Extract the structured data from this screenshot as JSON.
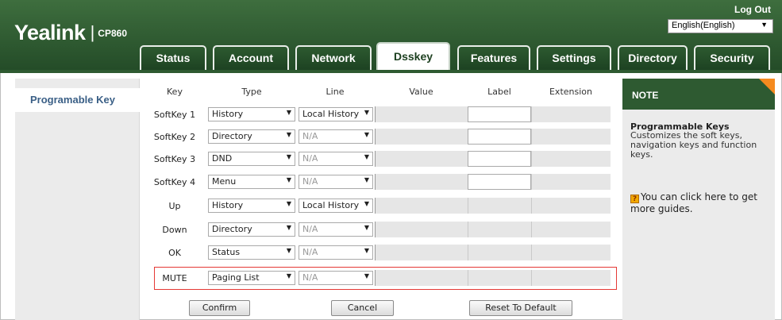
{
  "header": {
    "brand": "Yealink",
    "model": "CP860",
    "logout": "Log Out",
    "language": "English(English)"
  },
  "tabs": [
    {
      "label": "Status",
      "active": false
    },
    {
      "label": "Account",
      "active": false
    },
    {
      "label": "Network",
      "active": false
    },
    {
      "label": "Dsskey",
      "active": true
    },
    {
      "label": "Features",
      "active": false
    },
    {
      "label": "Settings",
      "active": false
    },
    {
      "label": "Directory",
      "active": false
    },
    {
      "label": "Security",
      "active": false
    }
  ],
  "sidebar": {
    "items": [
      {
        "label": "Programable Key",
        "selected": true
      }
    ]
  },
  "table": {
    "headers": {
      "key": "Key",
      "type": "Type",
      "line": "Line",
      "value": "Value",
      "label": "Label",
      "extension": "Extension"
    },
    "rows": [
      {
        "key": "SoftKey 1",
        "type": "History",
        "line": "Local History",
        "line_enabled": true
      },
      {
        "key": "SoftKey 2",
        "type": "Directory",
        "line": "N/A",
        "line_enabled": false
      },
      {
        "key": "SoftKey 3",
        "type": "DND",
        "line": "N/A",
        "line_enabled": false
      },
      {
        "key": "SoftKey 4",
        "type": "Menu",
        "line": "N/A",
        "line_enabled": false
      },
      {
        "key": "Up",
        "type": "History",
        "line": "Local History",
        "line_enabled": true
      },
      {
        "key": "Down",
        "type": "Directory",
        "line": "N/A",
        "line_enabled": false
      },
      {
        "key": "OK",
        "type": "Status",
        "line": "N/A",
        "line_enabled": false
      },
      {
        "key": "MUTE",
        "type": "Paging List",
        "line": "N/A",
        "line_enabled": false
      }
    ]
  },
  "buttons": {
    "confirm": "Confirm",
    "cancel": "Cancel",
    "reset": "Reset To Default"
  },
  "note": {
    "header": "NOTE",
    "title": "Programmable Keys",
    "body": "Customizes the soft keys, navigation keys and function keys.",
    "guide_icon": "help-icon",
    "guide": "You can click here to get more guides."
  },
  "colors": {
    "header_green": "#2e5a31",
    "highlight_red": "#e53935",
    "note_corner": "#f58a1f"
  }
}
